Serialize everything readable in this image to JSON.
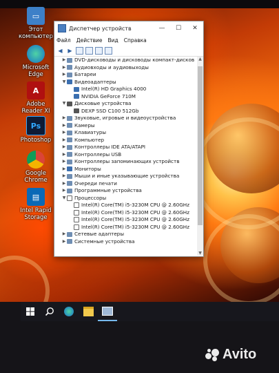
{
  "desktop_icons": [
    {
      "label": "Этот компьютер",
      "icon": "computer-icon"
    },
    {
      "label": "Microsoft Edge",
      "icon": "edge-icon"
    },
    {
      "label": "Adobe Reader XI",
      "icon": "pdf-icon"
    },
    {
      "label": "Photoshop",
      "icon": "photoshop-icon"
    },
    {
      "label": "Google Chrome",
      "icon": "chrome-icon"
    },
    {
      "label": "Intel Rapid Storage",
      "icon": "intel-storage-icon"
    }
  ],
  "window": {
    "title": "Диспетчер устройств",
    "controls": {
      "minimize": "—",
      "maximize": "☐",
      "close": "✕"
    },
    "menu": [
      "Файл",
      "Действие",
      "Вид",
      "Справка"
    ],
    "tree": [
      {
        "label": "DVD-дисководы и дисководы компакт-дисков",
        "level": 1,
        "expanded": false,
        "icon": "dvd-icon"
      },
      {
        "label": "Аудиовходы и аудиовыходы",
        "level": 1,
        "expanded": false,
        "icon": "audio-icon"
      },
      {
        "label": "Батареи",
        "level": 1,
        "expanded": false,
        "icon": "battery-icon"
      },
      {
        "label": "Видеоадаптеры",
        "level": 1,
        "expanded": true,
        "icon": "monitor-icon"
      },
      {
        "label": "Intel(R) HD Graphics 4000",
        "level": 2,
        "icon": "monitor-icon"
      },
      {
        "label": "NVIDIA GeForce 710M",
        "level": 2,
        "icon": "monitor-icon"
      },
      {
        "label": "Дисковые устройства",
        "level": 1,
        "expanded": true,
        "icon": "disk-icon"
      },
      {
        "label": "DEXP SSD C100 512Gb",
        "level": 2,
        "icon": "disk-icon"
      },
      {
        "label": "Звуковые, игровые и видеоустройства",
        "level": 1,
        "expanded": false,
        "icon": "sound-icon"
      },
      {
        "label": "Камеры",
        "level": 1,
        "expanded": false,
        "icon": "camera-icon"
      },
      {
        "label": "Клавиатуры",
        "level": 1,
        "expanded": false,
        "icon": "keyboard-icon"
      },
      {
        "label": "Компьютер",
        "level": 1,
        "expanded": false,
        "icon": "computer-icon"
      },
      {
        "label": "Контроллеры IDE ATA/ATAPI",
        "level": 1,
        "expanded": false,
        "icon": "controller-icon"
      },
      {
        "label": "Контроллеры USB",
        "level": 1,
        "expanded": false,
        "icon": "usb-icon"
      },
      {
        "label": "Контроллеры запоминающих устройств",
        "level": 1,
        "expanded": false,
        "icon": "storage-icon"
      },
      {
        "label": "Мониторы",
        "level": 1,
        "expanded": false,
        "icon": "monitor-icon"
      },
      {
        "label": "Мыши и иные указывающие устройства",
        "level": 1,
        "expanded": false,
        "icon": "mouse-icon"
      },
      {
        "label": "Очереди печати",
        "level": 1,
        "expanded": false,
        "icon": "printer-icon"
      },
      {
        "label": "Программные устройства",
        "level": 1,
        "expanded": false,
        "icon": "software-icon"
      },
      {
        "label": "Процессоры",
        "level": 1,
        "expanded": true,
        "icon": "cpu-icon"
      },
      {
        "label": "Intel(R) Core(TM) i5-3230M CPU @ 2.60GHz",
        "level": 2,
        "icon": "cpu-icon"
      },
      {
        "label": "Intel(R) Core(TM) i5-3230M CPU @ 2.60GHz",
        "level": 2,
        "icon": "cpu-icon"
      },
      {
        "label": "Intel(R) Core(TM) i5-3230M CPU @ 2.60GHz",
        "level": 2,
        "icon": "cpu-icon"
      },
      {
        "label": "Intel(R) Core(TM) i5-3230M CPU @ 2.60GHz",
        "level": 2,
        "icon": "cpu-icon"
      },
      {
        "label": "Сетевые адаптеры",
        "level": 1,
        "expanded": false,
        "icon": "network-icon"
      },
      {
        "label": "Системные устройства",
        "level": 1,
        "expanded": false,
        "icon": "system-icon"
      }
    ]
  },
  "taskbar": {
    "items": [
      "start-icon",
      "search-icon",
      "edge-icon",
      "file-explorer-icon",
      "device-manager-icon"
    ]
  },
  "watermark": {
    "text": "Avito"
  }
}
